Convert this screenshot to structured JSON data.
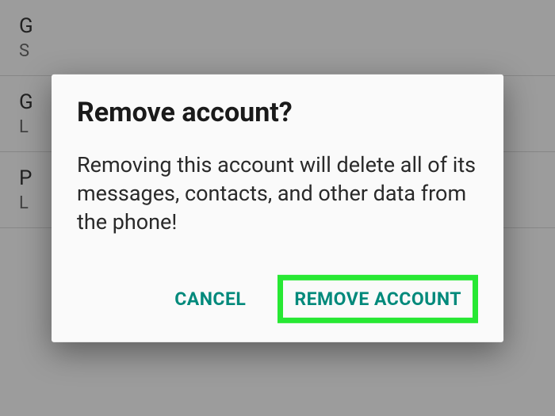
{
  "background": {
    "items": [
      {
        "title": "G",
        "subtitle": "S"
      },
      {
        "title": "G",
        "subtitle": "L"
      },
      {
        "title": "P",
        "subtitle": "L"
      }
    ]
  },
  "dialog": {
    "title": "Remove account?",
    "body": "Removing this account will delete all of its messages, contacts, and other data from the phone!",
    "cancel_label": "CANCEL",
    "confirm_label": "REMOVE ACCOUNT"
  },
  "colors": {
    "accent": "#00897b",
    "highlight": "#27e833"
  }
}
